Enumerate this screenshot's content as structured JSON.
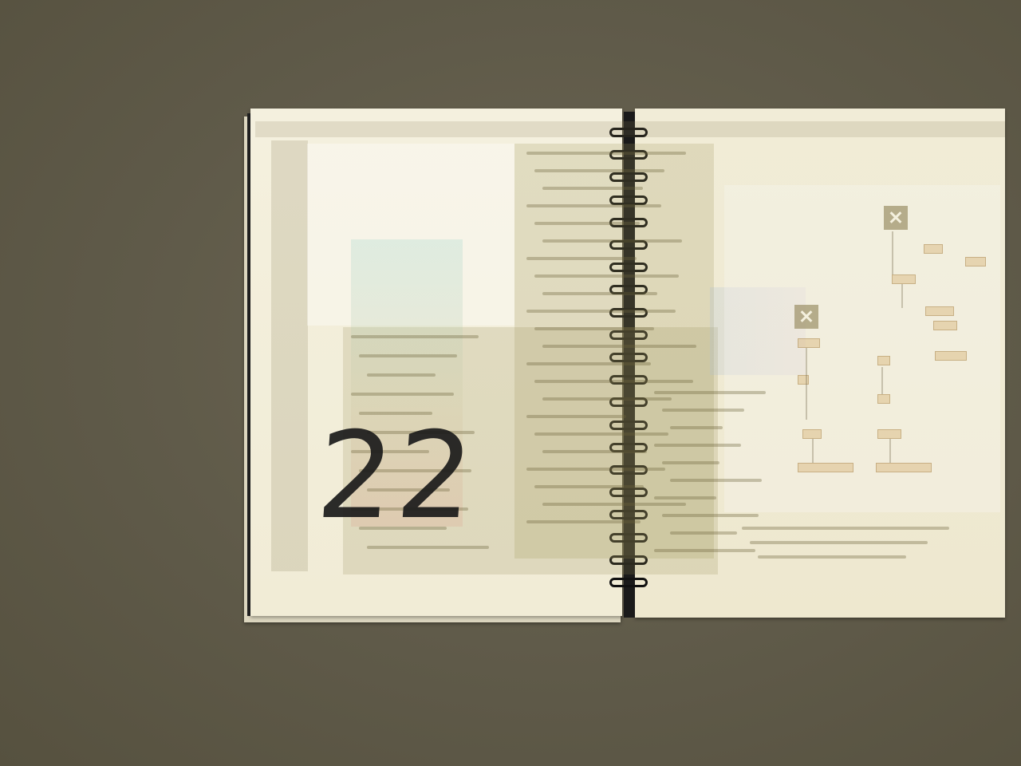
{
  "notebook": {
    "page_number": "22",
    "paper_color": "#f3efdc",
    "spine_color": "#1a1a1a",
    "background_color": "#5f5a49",
    "ring_count": 21
  },
  "projection": {
    "description_visible": false,
    "close_icon": "close-icon"
  }
}
